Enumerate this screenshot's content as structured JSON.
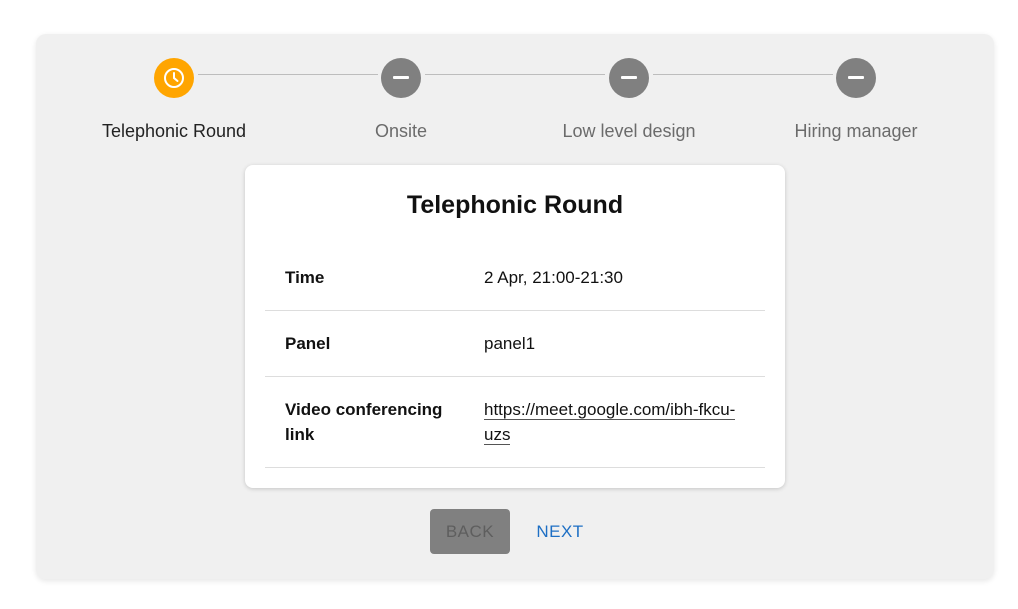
{
  "stepper": {
    "steps": [
      {
        "label": "Telephonic Round",
        "status": "active",
        "icon": "clock-icon"
      },
      {
        "label": "Onsite",
        "status": "pending",
        "icon": "minus-icon"
      },
      {
        "label": "Low level design",
        "status": "pending",
        "icon": "minus-icon"
      },
      {
        "label": "Hiring manager",
        "status": "pending",
        "icon": "minus-icon"
      }
    ]
  },
  "card": {
    "title": "Telephonic Round",
    "rows": [
      {
        "key": "Time",
        "value": "2 Apr, 21:00-21:30"
      },
      {
        "key": "Panel",
        "value": "panel1"
      },
      {
        "key": "Video conferencing link",
        "value": "https://meet.google.com/ibh-fkcu-uzs"
      }
    ]
  },
  "actions": {
    "back_label": "BACK",
    "next_label": "NEXT"
  },
  "colors": {
    "active_step": "#ffa500",
    "pending_step": "#808080",
    "next_link": "#1e6fc4",
    "panel_bg": "#f0f0f0"
  }
}
